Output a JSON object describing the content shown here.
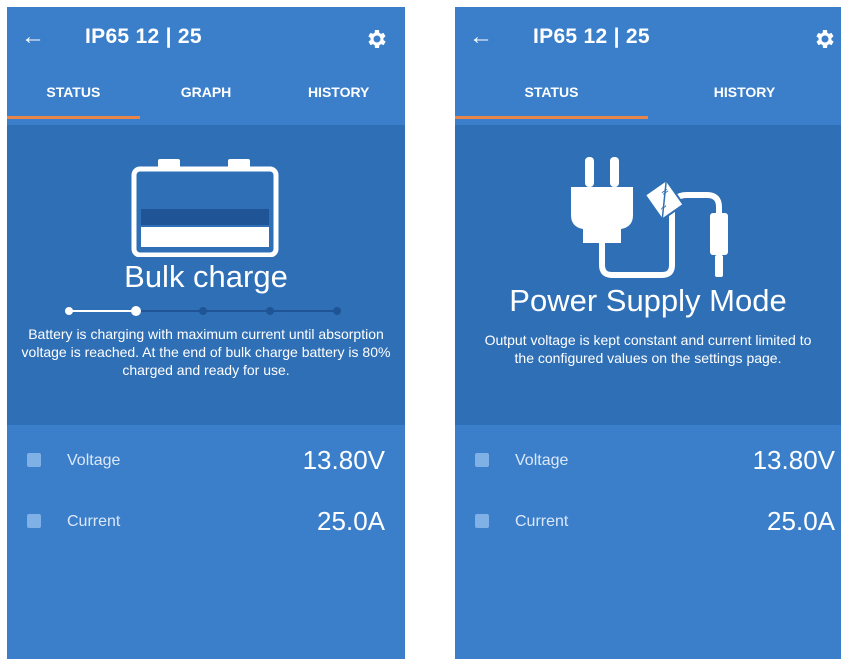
{
  "screens": [
    {
      "title": "IP65 12 | 25",
      "tabs": [
        "STATUS",
        "GRAPH",
        "HISTORY"
      ],
      "active_tab": "STATUS",
      "state_title": "Bulk charge",
      "state_description": "Battery is charging with maximum current until absorption voltage is reached. At the end of bulk charge battery is 80% charged and ready for use.",
      "charge_steps_total": 5,
      "charge_step_current": 2,
      "readings": [
        {
          "label": "Voltage",
          "value": "13.80V",
          "icon": "battery-voltage-icon"
        },
        {
          "label": "Current",
          "value": "25.0A",
          "icon": "current-icon"
        }
      ]
    },
    {
      "title": "IP65 12 | 25",
      "tabs": [
        "STATUS",
        "HISTORY"
      ],
      "active_tab": "STATUS",
      "state_title": "Power Supply Mode",
      "state_description": "Output voltage is kept constant and current limited to the configured values on the settings page.",
      "readings": [
        {
          "label": "Voltage",
          "value": "13.80V",
          "icon": "battery-voltage-icon"
        },
        {
          "label": "Current",
          "value": "25.0A",
          "icon": "current-icon"
        }
      ]
    }
  ],
  "colors": {
    "header": "#3b7fcb",
    "status_panel": "#2f6fb6",
    "tab_indicator": "#e8854a"
  }
}
